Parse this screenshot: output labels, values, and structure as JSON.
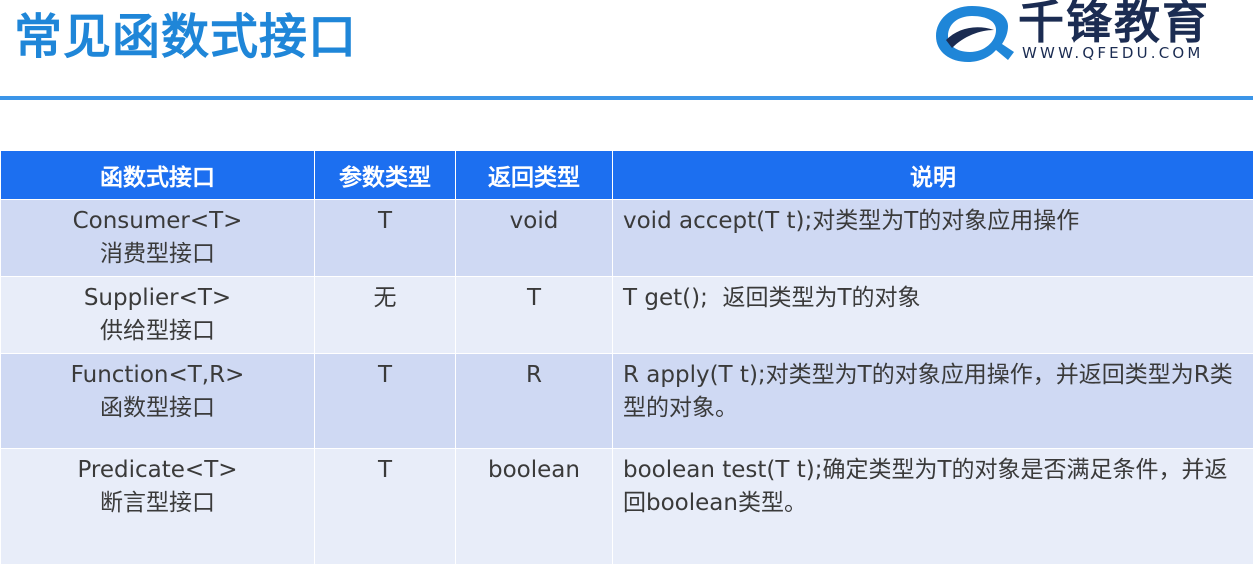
{
  "slide": {
    "title": "常见函数式接口",
    "logo_name": "千锋教育",
    "logo_url": "WWW.QFEDU.COM"
  },
  "table": {
    "headers": [
      "函数式接口",
      "参数类型",
      "返回类型",
      "说明"
    ],
    "rows": [
      {
        "interface": "Consumer<T>",
        "interface_cn": "消费型接口",
        "param_type": "T",
        "return_type": "void",
        "description": "void accept(T t);对类型为T的对象应用操作"
      },
      {
        "interface": "Supplier<T>",
        "interface_cn": "供给型接口",
        "param_type": "无",
        "return_type": "T",
        "description": "T get();  返回类型为T的对象"
      },
      {
        "interface": "Function<T,R>",
        "interface_cn": "函数型接口",
        "param_type": "T",
        "return_type": "R",
        "description": "R apply(T t);对类型为T的对象应用操作，并返回类型为R类型的对象。"
      },
      {
        "interface": "Predicate<T>",
        "interface_cn": "断言型接口",
        "param_type": "T",
        "return_type": "boolean",
        "description": "boolean test(T t);确定类型为T的对象是否满足条件，并返回boolean类型。"
      }
    ]
  },
  "colors": {
    "title": "#1f86d8",
    "rule": "#3b95e8",
    "header_bg": "#1c6ff0",
    "row_odd": "#cfd9f3",
    "row_even": "#e8edf9",
    "logo_text": "#1b2c52"
  }
}
